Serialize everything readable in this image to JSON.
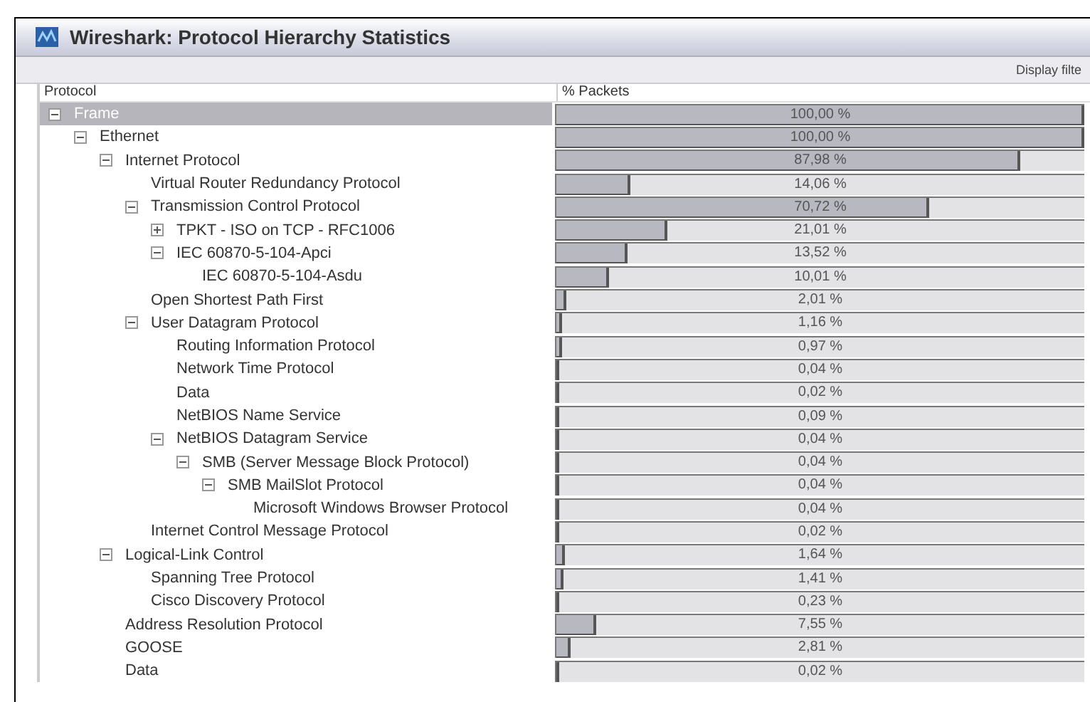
{
  "window": {
    "title": "Wireshark: Protocol Hierarchy Statistics"
  },
  "toolbar": {
    "display_filter_label": "Display filte"
  },
  "table": {
    "columns": [
      "Protocol",
      "% Packets"
    ],
    "rows": [
      {
        "name": "Frame",
        "percent": "100,00 %",
        "level": 1.0,
        "selected": true,
        "expanded": true,
        "children": [
          {
            "name": "Ethernet",
            "percent": "100,00 %",
            "level": 1.0,
            "selected": false,
            "expanded": true,
            "children": [
              {
                "name": "Internet Protocol",
                "percent": "87,98 %",
                "level": 0.8798,
                "selected": false,
                "expanded": true,
                "children": [
                  {
                    "name": "Virtual Router Redundancy Protocol",
                    "percent": "14,06 %",
                    "level": 0.1406,
                    "selected": false
                  },
                  {
                    "name": "Transmission Control Protocol",
                    "percent": "70,72 %",
                    "level": 0.7072,
                    "selected": false,
                    "expanded": true,
                    "children": [
                      {
                        "name": "TPKT - ISO on TCP - RFC1006",
                        "percent": "21,01 %",
                        "level": 0.2101,
                        "selected": false,
                        "expanded": false
                      },
                      {
                        "name": "IEC 60870-5-104-Apci",
                        "percent": "13,52 %",
                        "level": 0.1352,
                        "selected": false,
                        "expanded": true,
                        "children": [
                          {
                            "name": "IEC 60870-5-104-Asdu",
                            "percent": "10,01 %",
                            "level": 0.1001,
                            "selected": false
                          }
                        ]
                      }
                    ]
                  },
                  {
                    "name": "Open Shortest Path First",
                    "percent": "2,01 %",
                    "level": 0.0201,
                    "selected": false
                  },
                  {
                    "name": "User Datagram Protocol",
                    "percent": "1,16 %",
                    "level": 0.0116,
                    "selected": false,
                    "expanded": true,
                    "children": [
                      {
                        "name": "Routing Information Protocol",
                        "percent": "0,97 %",
                        "level": 0.0097,
                        "selected": false
                      },
                      {
                        "name": "Network Time Protocol",
                        "percent": "0,04 %",
                        "level": 0.0004,
                        "selected": false
                      },
                      {
                        "name": "Data",
                        "percent": "0,02 %",
                        "level": 0.0002,
                        "selected": false
                      },
                      {
                        "name": "NetBIOS Name Service",
                        "percent": "0,09 %",
                        "level": 0.0009,
                        "selected": false
                      },
                      {
                        "name": "NetBIOS Datagram Service",
                        "percent": "0,04 %",
                        "level": 0.0004,
                        "selected": false,
                        "expanded": true,
                        "children": [
                          {
                            "name": "SMB (Server Message Block Protocol)",
                            "percent": "0,04 %",
                            "level": 0.0004,
                            "selected": false,
                            "expanded": true,
                            "children": [
                              {
                                "name": "SMB MailSlot Protocol",
                                "percent": "0,04 %",
                                "level": 0.0004,
                                "selected": false,
                                "expanded": true,
                                "children": [
                                  {
                                    "name": "Microsoft Windows Browser Protocol",
                                    "percent": "0,04 %",
                                    "level": 0.0004,
                                    "selected": false
                                  }
                                ]
                              }
                            ]
                          }
                        ]
                      }
                    ]
                  },
                  {
                    "name": "Internet Control Message Protocol",
                    "percent": "0,02 %",
                    "level": 0.0002,
                    "selected": false
                  }
                ]
              },
              {
                "name": "Logical-Link Control",
                "percent": "1,64 %",
                "level": 0.0164,
                "selected": false,
                "expanded": true,
                "children": [
                  {
                    "name": "Spanning Tree Protocol",
                    "percent": "1,41 %",
                    "level": 0.0141,
                    "selected": false
                  },
                  {
                    "name": "Cisco Discovery Protocol",
                    "percent": "0,23 %",
                    "level": 0.0023,
                    "selected": false
                  }
                ]
              },
              {
                "name": "Address Resolution Protocol",
                "percent": "7,55 %",
                "level": 0.0755,
                "selected": false
              },
              {
                "name": "GOOSE",
                "percent": "2,81 %",
                "level": 0.0281,
                "selected": false
              },
              {
                "name": "Data",
                "percent": "0,02 %",
                "level": 0.0002,
                "selected": false
              }
            ]
          }
        ]
      }
    ]
  }
}
